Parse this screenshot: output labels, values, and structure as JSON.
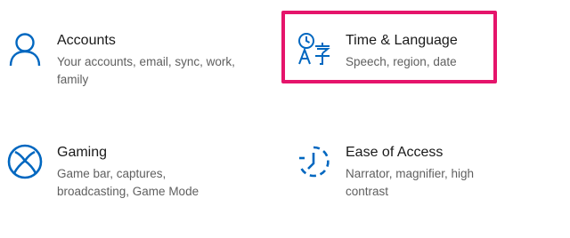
{
  "accent_color": "#0067c0",
  "highlight_color": "#e5146b",
  "tiles": [
    {
      "title": "Accounts",
      "description": "Your accounts, email, sync, work, family",
      "icon": "person-icon"
    },
    {
      "title": "Time & Language",
      "description": "Speech, region, date",
      "icon": "time-language-icon"
    },
    {
      "title": "Gaming",
      "description": "Game bar, captures, broadcasting, Game Mode",
      "icon": "xbox-icon"
    },
    {
      "title": "Ease of Access",
      "description": "Narrator, magnifier, high contrast",
      "icon": "ease-of-access-icon"
    }
  ]
}
